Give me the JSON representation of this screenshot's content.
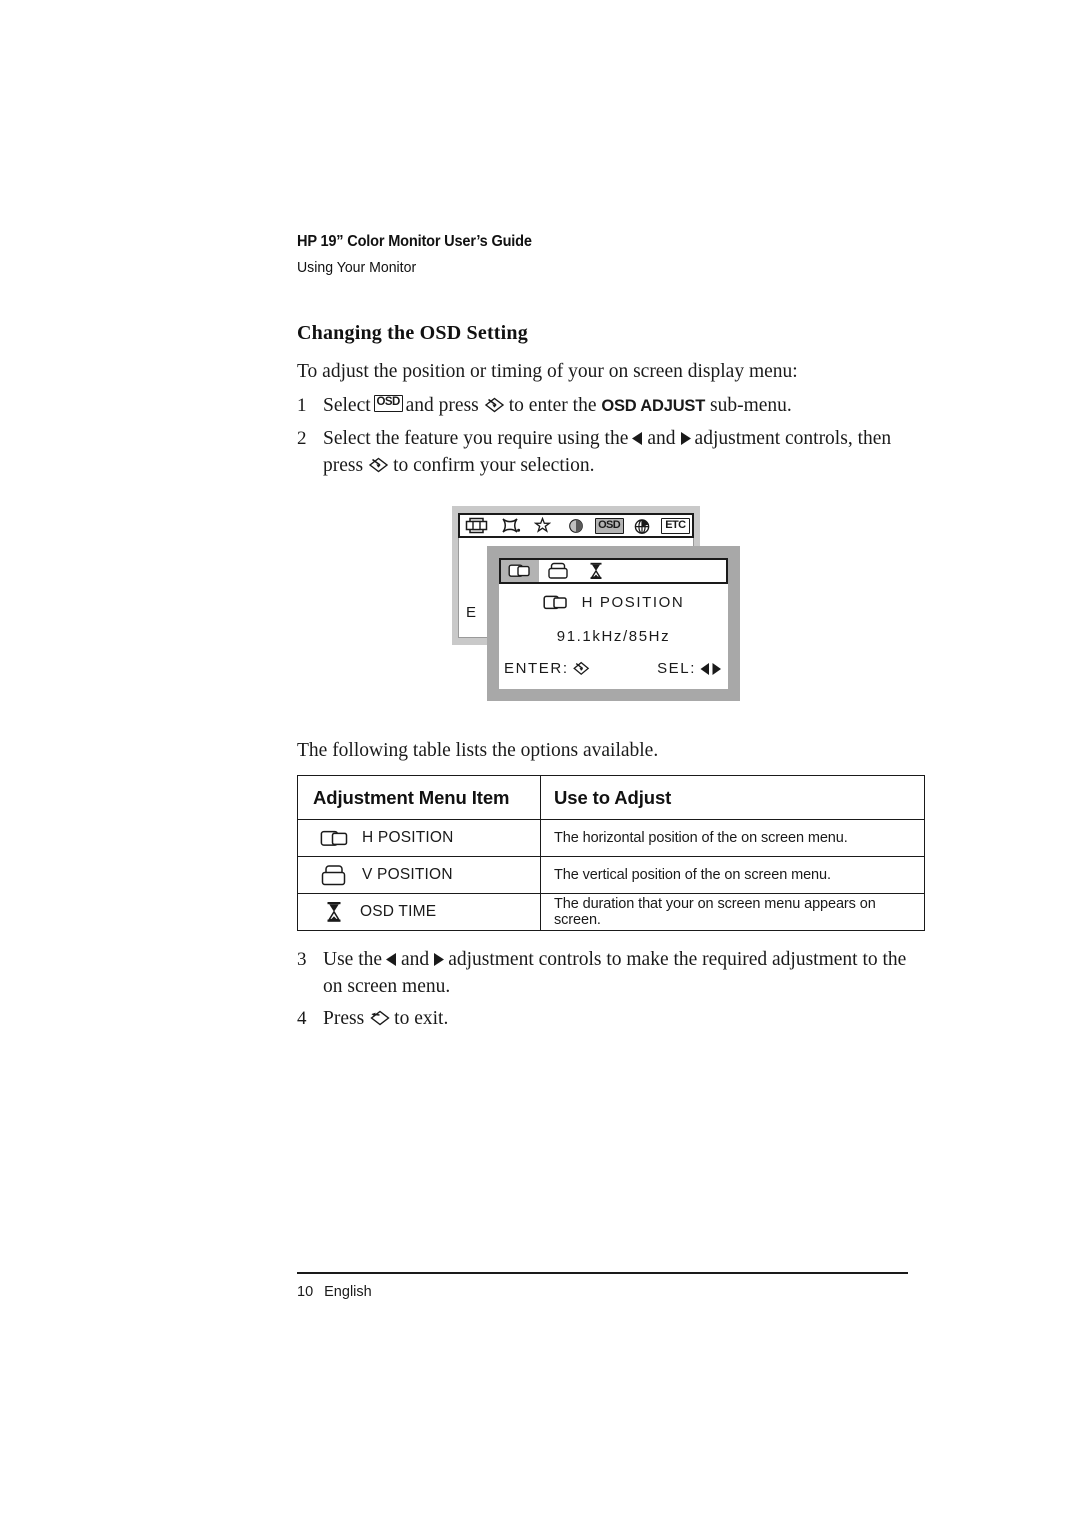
{
  "document": {
    "running_head_title": "HP 19” Color Monitor User’s Guide",
    "running_head_subtitle": "Using Your Monitor",
    "section_heading": "Changing the OSD Setting",
    "intro": "To adjust the position or timing of your on screen display menu:",
    "table_lead_in": "The following table lists the options available."
  },
  "steps": [
    {
      "number": "1",
      "parts": {
        "a": "Select",
        "icon_1": "osd-button-icon",
        "b": "and press",
        "icon_2": "enter-button-icon",
        "c": "to enter the",
        "emphasis": "OSD ADJUST",
        "d": "sub-menu."
      }
    },
    {
      "number": "2",
      "parts": {
        "a": "Select the feature you require using the",
        "icon_1": "left-arrow-icon",
        "b": "and",
        "icon_2": "right-arrow-icon",
        "c": "adjustment controls, then press",
        "icon_3": "enter-button-icon",
        "d": "to confirm your selection."
      }
    },
    {
      "number": "3",
      "parts": {
        "a": "Use the",
        "icon_1": "left-arrow-icon",
        "b": "and",
        "icon_2": "right-arrow-icon",
        "c": "adjustment controls to make the required adjustment to the on screen menu."
      }
    },
    {
      "number": "4",
      "parts": {
        "a": "Press",
        "icon_1": "exit-button-icon",
        "b": "to exit."
      }
    }
  ],
  "osd_illustration": {
    "back_menu": {
      "toolbar_icons": [
        "screen-size-icon",
        "pincushion-icon",
        "star-brightness-icon",
        "contrast-icon",
        "osd-icon",
        "globe-language-icon",
        "etc-icon"
      ],
      "selected_icon": "osd-icon",
      "osd_icon_label": "OSD",
      "etc_icon_label": "ETC",
      "partial_text": "E N"
    },
    "front_menu": {
      "toolbar_icons": [
        "h-position-icon",
        "v-position-icon",
        "osd-time-icon"
      ],
      "selected_icon": "h-position-icon",
      "item_icon": "h-position-icon",
      "item_label": "H POSITION",
      "frequency": "91.1kHz/85Hz",
      "enter_label": "ENTER:",
      "enter_icon": "enter-button-icon",
      "select_label": "SEL:",
      "select_icons": "left-right-arrows-icon"
    }
  },
  "table": {
    "headers": [
      "Adjustment Menu Item",
      "Use to Adjust"
    ],
    "rows": [
      {
        "icon": "h-position-icon",
        "item": "H POSITION",
        "description": "The horizontal position of the on screen menu."
      },
      {
        "icon": "v-position-icon",
        "item": "V POSITION",
        "description": "The vertical position of the on screen menu."
      },
      {
        "icon": "osd-time-icon",
        "item": "OSD TIME",
        "description": "The duration that your on screen menu appears on screen."
      }
    ]
  },
  "footer": {
    "page_number": "10",
    "language": "English"
  },
  "colors": {
    "text": "#1a1a1a",
    "osd_back_shadow": "#c9c9c9",
    "osd_front_shadow": "#a8a8a8",
    "osd_selected": "#b3b3b3"
  }
}
